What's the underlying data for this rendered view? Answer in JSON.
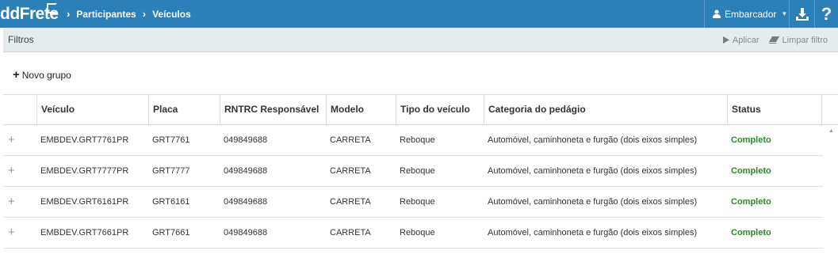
{
  "topbar": {
    "logo_text": "ddFrete",
    "breadcrumbs": [
      "Participantes",
      "Veículos"
    ],
    "user_label": "Embarcador",
    "help_label": "?"
  },
  "filters": {
    "title": "Filtros",
    "apply_label": "Aplicar",
    "clear_label": "Limpar filtro"
  },
  "groups": {
    "new_group_label": "Novo grupo"
  },
  "table": {
    "columns": [
      "Veículo",
      "Placa",
      "RNTRC Responsável",
      "Modelo",
      "Tipo do veículo",
      "Categoria do pedágio",
      "Status"
    ],
    "rows": [
      {
        "veiculo": "EMBDEV.GRT7761PR",
        "placa": "GRT7761",
        "rntrc": "049849688",
        "modelo": "CARRETA",
        "tipo": "Reboque",
        "categoria": "Automóvel, caminhoneta e furgão (dois eixos simples)",
        "status": "Completo"
      },
      {
        "veiculo": "EMBDEV.GRT7777PR",
        "placa": "GRT7777",
        "rntrc": "049849688",
        "modelo": "CARRETA",
        "tipo": "Reboque",
        "categoria": "Automóvel, caminhoneta e furgão (dois eixos simples)",
        "status": "Completo"
      },
      {
        "veiculo": "EMBDEV.GRT6161PR",
        "placa": "GRT6161",
        "rntrc": "049849688",
        "modelo": "CARRETA",
        "tipo": "Reboque",
        "categoria": "Automóvel, caminhoneta e furgão (dois eixos simples)",
        "status": "Completo"
      },
      {
        "veiculo": "EMBDEV.GRT7661PR",
        "placa": "GRT7661",
        "rntrc": "049849688",
        "modelo": "CARRETA",
        "tipo": "Reboque",
        "categoria": "Automóvel, caminhoneta e furgão (dois eixos simples)",
        "status": "Completo"
      }
    ]
  },
  "colors": {
    "topbar": "#2d7fb8",
    "filters_bg": "#e4ecee",
    "status_complete": "#2a8a24"
  },
  "icons": [
    "user-icon",
    "chevron-down-icon",
    "download-icon",
    "help-icon",
    "play-icon",
    "eraser-icon",
    "plus-icon",
    "expand-icon"
  ]
}
